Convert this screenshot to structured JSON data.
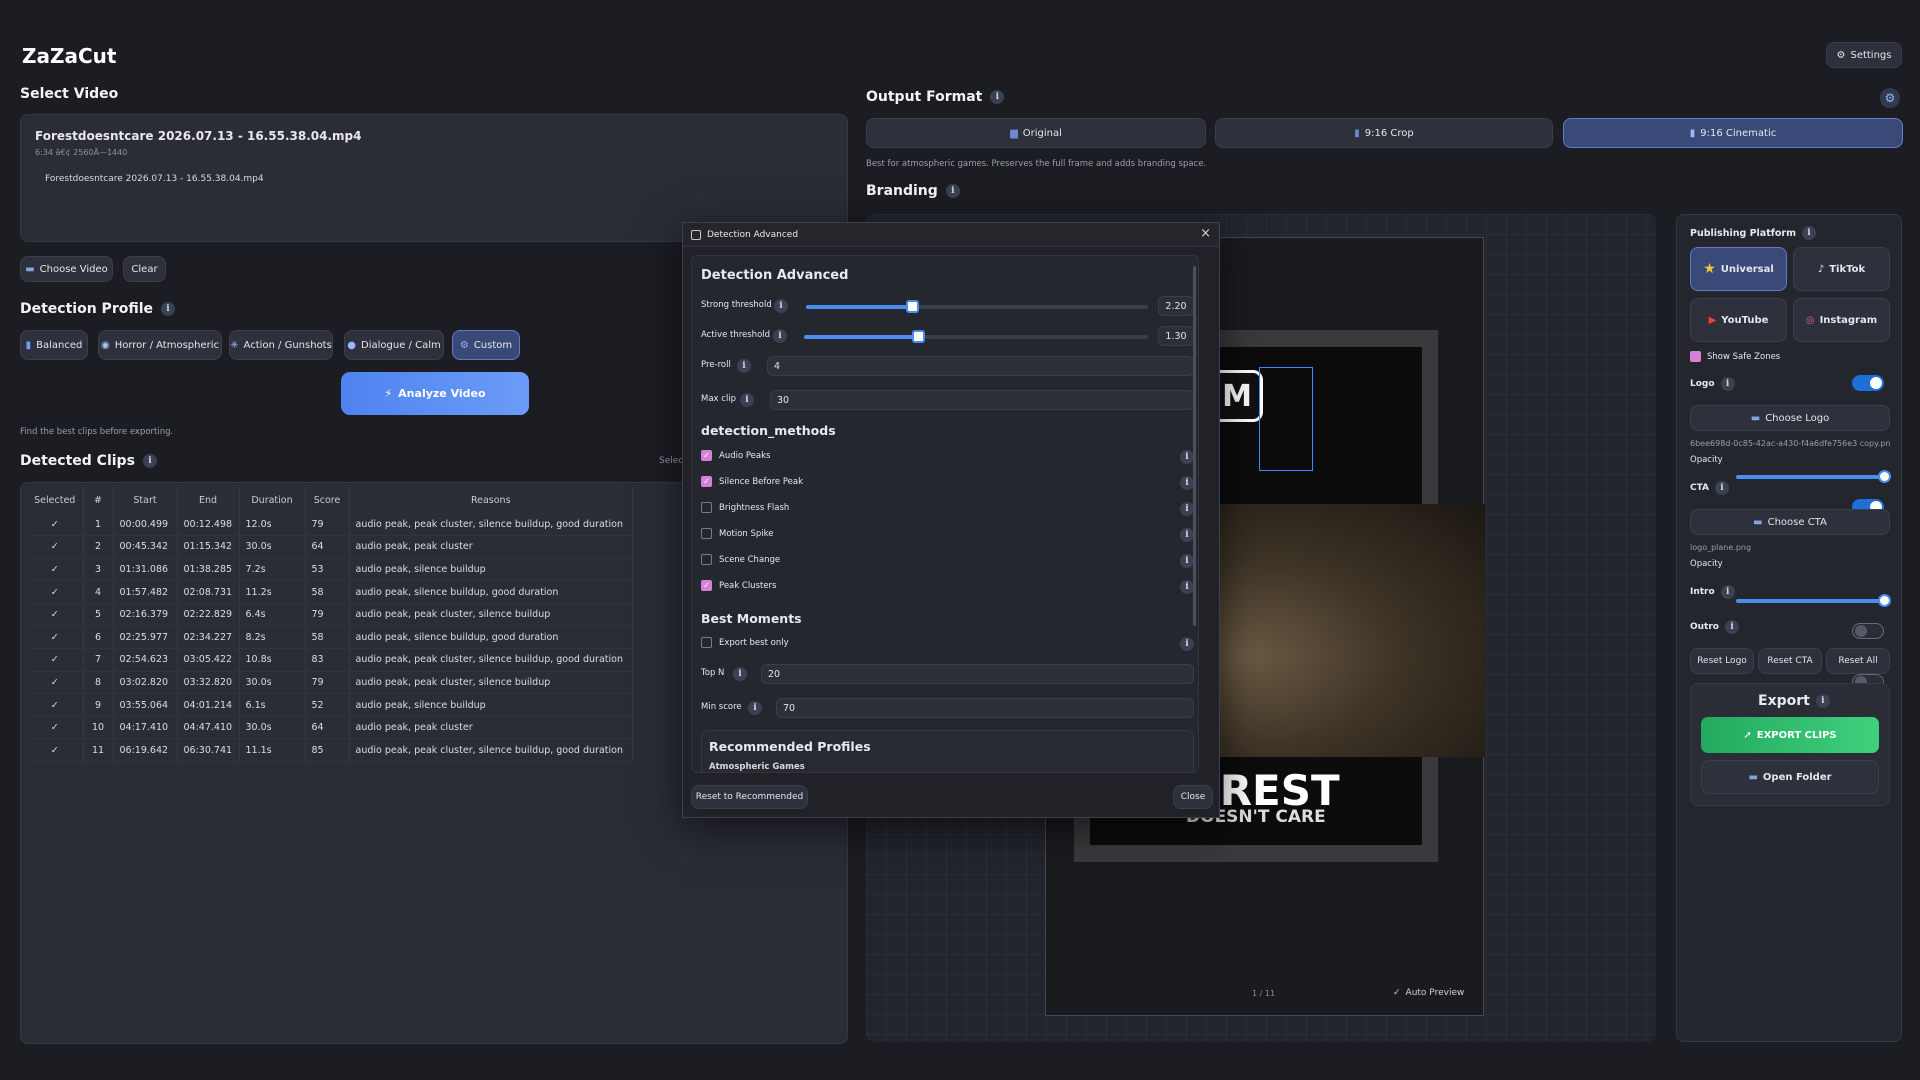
{
  "app": {
    "title": "ZaZaCut",
    "settings_label": "Settings"
  },
  "select_video": {
    "heading": "Select Video",
    "filename": "Forestdoesntcare 2026.07.13 - 16.55.38.04.mp4",
    "meta": "6:34 â€¢ 2560Ã—1440",
    "list_item": "Forestdoesntcare 2026.07.13 - 16.55.38.04.mp4",
    "choose_label": "Choose Video",
    "clear_label": "Clear"
  },
  "detection_profile": {
    "heading": "Detection Profile",
    "profiles": [
      {
        "label": "Balanced",
        "icon": "bar-chart-icon"
      },
      {
        "label": "Horror / Atmospheric",
        "icon": "ghost-icon"
      },
      {
        "label": "Action / Gunshots",
        "icon": "burst-icon"
      },
      {
        "label": "Dialogue / Calm",
        "icon": "speech-icon"
      },
      {
        "label": "Custom",
        "icon": "gear-icon"
      }
    ],
    "selected": "Custom",
    "analyze_label": "Analyze Video",
    "hint": "Find the best clips before exporting."
  },
  "detected_clips": {
    "heading": "Detected Clips",
    "select_link": "Select",
    "columns": [
      "Selected",
      "#",
      "Start",
      "End",
      "Duration",
      "Score",
      "Reasons"
    ],
    "rows": [
      {
        "sel": "✓",
        "n": "1",
        "start": "00:00.499",
        "end": "00:12.498",
        "dur": "12.0s",
        "score": "79",
        "reasons": "audio peak, peak cluster, silence buildup, good duration"
      },
      {
        "sel": "✓",
        "n": "2",
        "start": "00:45.342",
        "end": "01:15.342",
        "dur": "30.0s",
        "score": "64",
        "reasons": "audio peak, peak cluster"
      },
      {
        "sel": "✓",
        "n": "3",
        "start": "01:31.086",
        "end": "01:38.285",
        "dur": "7.2s",
        "score": "53",
        "reasons": "audio peak, silence buildup"
      },
      {
        "sel": "✓",
        "n": "4",
        "start": "01:57.482",
        "end": "02:08.731",
        "dur": "11.2s",
        "score": "58",
        "reasons": "audio peak, silence buildup, good duration"
      },
      {
        "sel": "✓",
        "n": "5",
        "start": "02:16.379",
        "end": "02:22.829",
        "dur": "6.4s",
        "score": "79",
        "reasons": "audio peak, peak cluster, silence buildup"
      },
      {
        "sel": "✓",
        "n": "6",
        "start": "02:25.977",
        "end": "02:34.227",
        "dur": "8.2s",
        "score": "58",
        "reasons": "audio peak, silence buildup, good duration"
      },
      {
        "sel": "✓",
        "n": "7",
        "start": "02:54.623",
        "end": "03:05.422",
        "dur": "10.8s",
        "score": "83",
        "reasons": "audio peak, peak cluster, silence buildup, good duration"
      },
      {
        "sel": "✓",
        "n": "8",
        "start": "03:02.820",
        "end": "03:32.820",
        "dur": "30.0s",
        "score": "79",
        "reasons": "audio peak, peak cluster, silence buildup"
      },
      {
        "sel": "✓",
        "n": "9",
        "start": "03:55.064",
        "end": "04:01.214",
        "dur": "6.1s",
        "score": "52",
        "reasons": "audio peak, silence buildup"
      },
      {
        "sel": "✓",
        "n": "10",
        "start": "04:17.410",
        "end": "04:47.410",
        "dur": "30.0s",
        "score": "64",
        "reasons": "audio peak, peak cluster"
      },
      {
        "sel": "✓",
        "n": "11",
        "start": "06:19.642",
        "end": "06:30.741",
        "dur": "11.1s",
        "score": "85",
        "reasons": "audio peak, peak cluster, silence buildup, good duration"
      }
    ]
  },
  "output_format": {
    "heading": "Output Format",
    "options": [
      "Original",
      "9:16 Crop",
      "9:16 Cinematic"
    ],
    "selected": "9:16 Cinematic",
    "description": "Best for atmospheric games. Preserves the full frame and adds branding space."
  },
  "branding": {
    "heading": "Branding",
    "preview_counter": "1 / 11",
    "auto_preview": "Auto Preview",
    "logo_title_1": "OREST",
    "logo_title_2": "DOESN'T CARE"
  },
  "publishing": {
    "heading": "Publishing Platform",
    "platforms": [
      {
        "label": "Universal",
        "icon": "star-icon"
      },
      {
        "label": "TikTok",
        "icon": "tiktok-icon"
      },
      {
        "label": "YouTube",
        "icon": "youtube-icon"
      },
      {
        "label": "Instagram",
        "icon": "instagram-icon"
      }
    ],
    "selected": "Universal",
    "safe_zones": "Show Safe Zones",
    "logo_label": "Logo",
    "choose_logo": "Choose Logo",
    "logo_file": "6bee698d-0c85-42ac-a430-f4a6dfe756e3 copy.png",
    "opacity_label": "Opacity",
    "cta_label": "CTA",
    "choose_cta": "Choose CTA",
    "cta_file": "logo_plane.png",
    "intro_label": "Intro",
    "outro_label": "Outro",
    "reset_logo": "Reset Logo",
    "reset_cta": "Reset CTA",
    "reset_all": "Reset All",
    "logo_opacity": 1.0,
    "cta_opacity": 1.0
  },
  "export": {
    "heading": "Export",
    "export_label": "EXPORT CLIPS",
    "open_folder": "Open Folder"
  },
  "dialog": {
    "window_title": "Detection Advanced",
    "heading": "Detection Advanced",
    "strong_label": "Strong threshold",
    "strong_value": "2.20",
    "strong_fraction": 0.31,
    "active_label": "Active threshold",
    "active_value": "1.30",
    "active_fraction": 0.33,
    "preroll_label": "Pre-roll",
    "preroll_value": "4",
    "maxclip_label": "Max clip",
    "maxclip_value": "30",
    "methods_heading": "detection_methods",
    "methods": [
      {
        "label": "Audio Peaks",
        "on": true
      },
      {
        "label": "Silence Before Peak",
        "on": true
      },
      {
        "label": "Brightness Flash",
        "on": false
      },
      {
        "label": "Motion Spike",
        "on": false
      },
      {
        "label": "Scene Change",
        "on": false
      },
      {
        "label": "Peak Clusters",
        "on": true
      }
    ],
    "best_heading": "Best Moments",
    "export_best": "Export best only",
    "topn_label": "Top N",
    "topn_value": "20",
    "minscore_label": "Min score",
    "minscore_value": "70",
    "recommended_heading": "Recommended Profiles",
    "recommended_sub": "Atmospheric Games",
    "reset_label": "Reset to Recommended",
    "close_label": "Close"
  },
  "colors": {
    "accent": "#4a8cf0",
    "export_green": "#2fbf71",
    "analyze": "#5b8ef5",
    "checkbox": "#d780d7"
  }
}
